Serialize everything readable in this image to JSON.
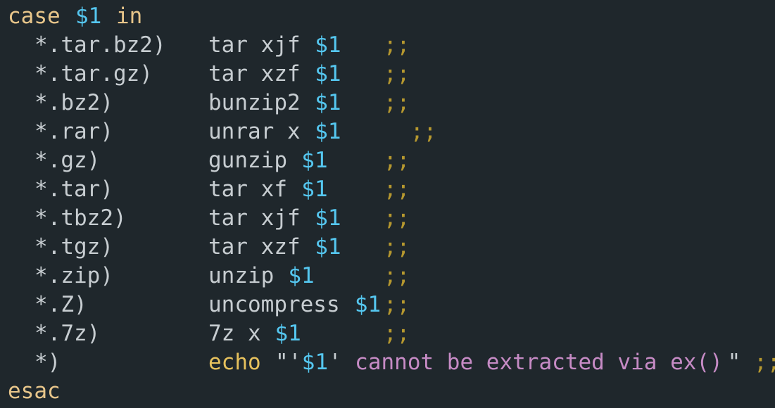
{
  "editor": {
    "colors": {
      "background": "#1f272c",
      "keyword": "#e7c58a",
      "text": "#c7cdd1",
      "variable": "#55c7f0",
      "separator": "#b6982f",
      "string": "#c68bc5",
      "echo": "#e6c15d"
    },
    "header": {
      "kw_case": "case",
      "var": "$1",
      "kw_in": "in"
    },
    "cases": [
      {
        "pattern": "*.tar.bz2)",
        "cmd": "tar xjf ",
        "var": "$1",
        "sep": ";;"
      },
      {
        "pattern": "*.tar.gz)",
        "cmd": "tar xzf ",
        "var": "$1",
        "sep": ";;"
      },
      {
        "pattern": "*.bz2)",
        "cmd": "bunzip2 ",
        "var": "$1",
        "sep": ";;"
      },
      {
        "pattern": "*.rar)",
        "cmd": "unrar x ",
        "var": "$1",
        "sep": ";;"
      },
      {
        "pattern": "*.gz)",
        "cmd": "gunzip ",
        "var": "$1",
        "sep": ";;"
      },
      {
        "pattern": "*.tar)",
        "cmd": "tar xf ",
        "var": "$1",
        "sep": ";;"
      },
      {
        "pattern": "*.tbz2)",
        "cmd": "tar xjf ",
        "var": "$1",
        "sep": ";;"
      },
      {
        "pattern": "*.tgz)",
        "cmd": "tar xzf ",
        "var": "$1",
        "sep": ";;"
      },
      {
        "pattern": "*.zip)",
        "cmd": "unzip ",
        "var": "$1",
        "sep": ";;"
      },
      {
        "pattern": "*.Z)",
        "cmd": "uncompress ",
        "var": "$1",
        "sep": ";;"
      },
      {
        "pattern": "*.7z)",
        "cmd": "7z x ",
        "var": "$1",
        "sep": ";;"
      }
    ],
    "default_case": {
      "pattern": "*)",
      "cmd": "echo",
      "quote_open": "\"'",
      "var": "$1",
      "quote_mid": "'",
      "message": " cannot be extracted via ex()",
      "quote_close": "\"",
      "sep": " ;;"
    },
    "footer": {
      "kw_esac": "esac"
    }
  }
}
